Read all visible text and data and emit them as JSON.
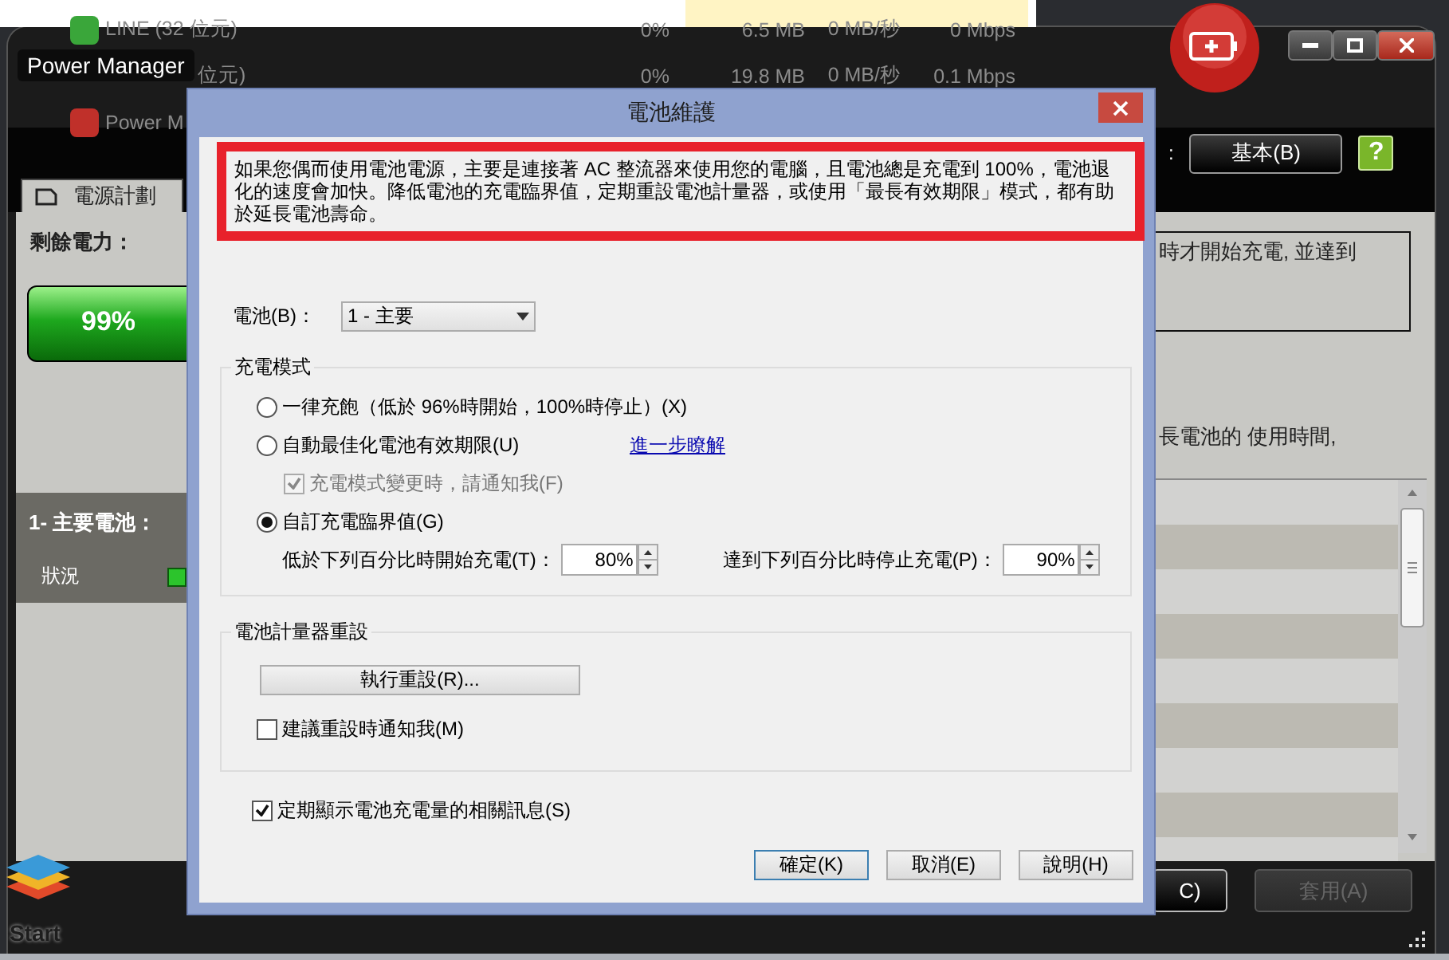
{
  "task_manager": {
    "rows": [
      {
        "cells": [
          "LINE (32 位元)",
          "0%",
          "6.5 MB",
          "0 MB/秒",
          "0 Mbps"
        ],
        "color": "#3aa63a"
      },
      {
        "cells": [
          "位元)",
          "0%",
          "19.8 MB",
          "0 MB/秒",
          "0.1 Mbps"
        ]
      },
      {
        "cells": [
          "Power M"
        ],
        "color": "#c0302a"
      }
    ]
  },
  "desktop": {
    "start_label": "Start"
  },
  "power_manager": {
    "title": "Power Manager",
    "tabs": [
      {
        "label": "電源計劃",
        "selected": true
      }
    ],
    "mode_separator": ":",
    "mode_button": "基本(B)",
    "help_label": "?",
    "remaining_label": "剩餘電力：",
    "battery": {
      "reading": "99%",
      "level": 0.99
    },
    "battery_name": "1- 主要電池：",
    "status_label": "狀況",
    "description_1": "時才開始充電, 並達到",
    "description_2": "長電池的 使用時間,",
    "buttons": [
      {
        "label": "C)",
        "disabled": false
      },
      {
        "label": "套用(A)",
        "disabled": true
      }
    ]
  },
  "dialog": {
    "title": "電池維護",
    "notice": "如果您偶而使用電池電源，主要是連接著 AC 整流器來使用您的電腦，且電池總是充電到 100%，電池退化的速度會加快。降低電池的充電臨界值，定期重設電池計量器，或使用「最長有效期限」模式，都有助於延長電池壽命。",
    "battery_label": "電池(B)：",
    "battery_select": "1 - 主要",
    "charge_mode": {
      "title": "充電模式",
      "options": [
        {
          "label": "一律充飽（低於 96%時開始，100%時停止）(X)",
          "selected": false
        },
        {
          "label": "自動最佳化電池有效期限(U)",
          "selected": false,
          "link": "進一步瞭解",
          "sub_option": {
            "label": "充電模式變更時，請通知我(F)",
            "checked": true,
            "disabled": true
          }
        },
        {
          "label": "自訂充電臨界值(G)",
          "selected": true
        }
      ],
      "thresholds": [
        {
          "label": "低於下列百分比時開始充電(T)：",
          "value": "80%"
        },
        {
          "label": "達到下列百分比時停止充電(P)：",
          "value": "90%"
        }
      ]
    },
    "gauge_reset": {
      "title": "電池計量器重設",
      "button": "執行重設(R)...",
      "notify": {
        "label": "建議重設時通知我(M)",
        "checked": false,
        "disabled": false
      }
    },
    "show_info": {
      "label": "定期顯示電池充電量的相關訊息(S)",
      "checked": true,
      "disabled": false
    },
    "buttons": [
      {
        "label": "確定(K)",
        "default": true
      },
      {
        "label": "取消(E)",
        "default": false
      },
      {
        "label": "說明(H)",
        "default": false
      }
    ]
  }
}
